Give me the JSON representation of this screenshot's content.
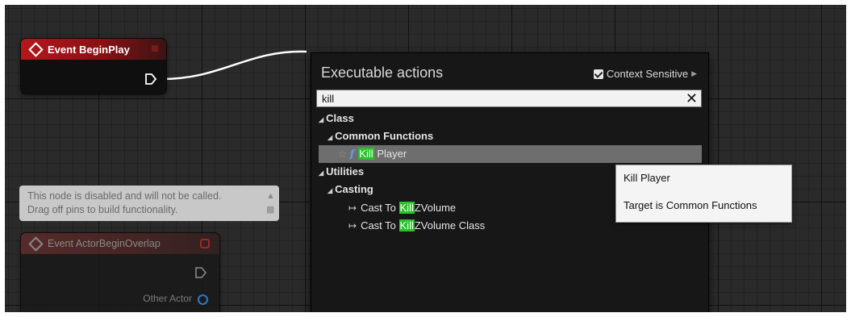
{
  "nodes": {
    "begin_play": {
      "title": "Event BeginPlay"
    },
    "disabled_comment": {
      "line1": "This node is disabled and will not be called.",
      "line2": "Drag off pins to build functionality."
    },
    "actor_overlap": {
      "title": "Event ActorBeginOverlap",
      "pin_label": "Other Actor"
    }
  },
  "menu": {
    "title": "Executable actions",
    "context_sensitive": {
      "label": "Context Sensitive",
      "checked": true
    },
    "search": {
      "value": "kill"
    },
    "tree": {
      "class_label": "Class",
      "common_functions_label": "Common Functions",
      "kill_player": {
        "match": "Kill",
        "rest": " Player",
        "icon": "function-icon"
      },
      "utilities_label": "Utilities",
      "casting_label": "Casting",
      "cast_items": [
        {
          "prefix": "Cast To ",
          "match": "Kill",
          "rest": "ZVolume"
        },
        {
          "prefix": "Cast To ",
          "match": "Kill",
          "rest": "ZVolume Class"
        }
      ]
    }
  },
  "tooltip": {
    "title": "Kill Player",
    "target": "Target is Common Functions"
  },
  "colors": {
    "event_red": "#b4171c",
    "match_green": "#2ac02a",
    "object_pin_blue": "#2a8ad8"
  }
}
